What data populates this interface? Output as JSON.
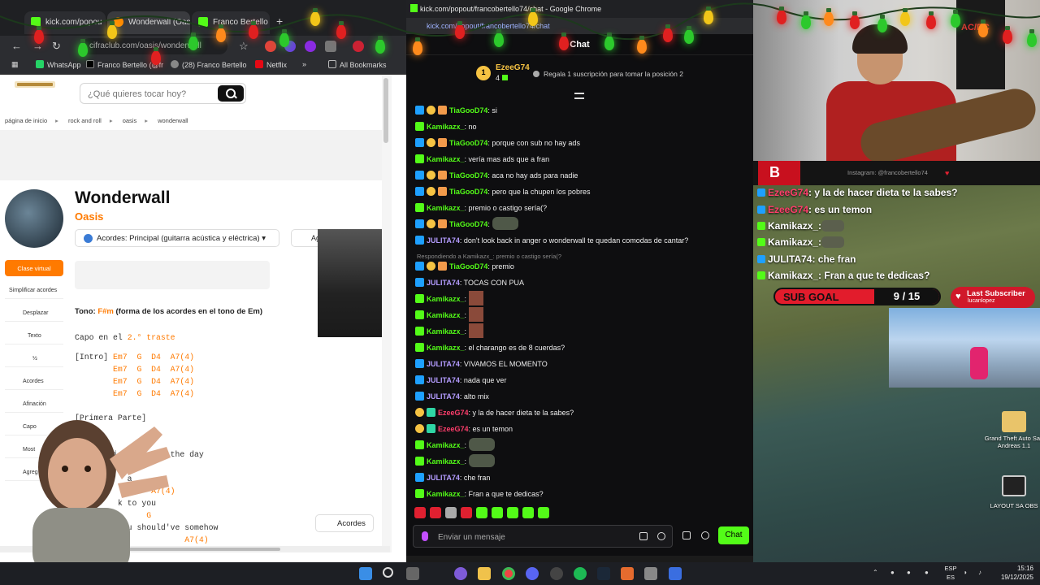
{
  "left_browser": {
    "tabs": [
      {
        "title": "kick.com/popou"
      },
      {
        "title": "Wonderwall (Oasis"
      },
      {
        "title": "Franco Bertello"
      }
    ],
    "url": "cifraclub.com/oasis/wonderwall",
    "bookmarks": [
      "WhatsApp",
      "Franco Bertello (@fr",
      "(28) Franco Bertello",
      "Netflix",
      "All Bookmarks"
    ],
    "site": {
      "search_placeholder": "¿Qué quieres tocar hoy?",
      "breadcrumb": [
        "página de inicio",
        "rock and roll",
        "oasis",
        "wonderwall"
      ],
      "song_title": "Wonderwall",
      "artist": "Oasis",
      "chords_select": "Acordes: Principal (guitarra acústica y eléctrica)",
      "ag_button": "Ag",
      "clase_virtual": "Clase virtual",
      "side_tools": [
        "Simplificar acordes",
        "Desplazar",
        "Texto",
        "½",
        "Acordes",
        "Afinación",
        "Capo",
        "Most",
        "Agreg"
      ],
      "tono_label": "Tono:",
      "tono_key": "F#m",
      "tono_desc": "(forma de los acordes en el tono de Em)",
      "capo_label": "Capo en el",
      "capo_value": "2.° traste",
      "intro_label": "[Intro]",
      "intro_chords": [
        "Em7",
        "G",
        "D4",
        "A7(4)"
      ],
      "primera_parte": "[Primera Parte]",
      "lyric_chords": [
        "G",
        "D4",
        "A7(4)",
        "G",
        "A7(4)"
      ],
      "lyric_lines": [
        "y is gonna be the day",
        "a",
        "k to you",
        "you should've somehow"
      ],
      "acordes_button": "Acordes"
    }
  },
  "chat": {
    "window_title": "kick.com/popout/francobertello74/chat - Google Chrome",
    "url": "kick.com/popout/francobertello74/chat",
    "header": "Chat",
    "pinned": {
      "rank": "1",
      "user": "EzeeG74",
      "count": "4",
      "gift_text": "Regala 1 suscripción para tomar la posición 2"
    },
    "messages": [
      {
        "user": "TiaGooD74",
        "color": "#53fc18",
        "text": ": si",
        "badges": [
          "blue",
          "gold",
          "cake"
        ]
      },
      {
        "user": "Kamikazx_",
        "color": "#53fc18",
        "text": ": no",
        "badges": [
          "green"
        ]
      },
      {
        "user": "TiaGooD74",
        "color": "#53fc18",
        "text": ": porque con sub no hay ads",
        "badges": [
          "blue",
          "gold",
          "cake"
        ]
      },
      {
        "user": "Kamikazx_",
        "color": "#53fc18",
        "text": ": vería mas ads que a fran",
        "badges": [
          "green"
        ]
      },
      {
        "user": "TiaGooD74",
        "color": "#53fc18",
        "text": ": aca no hay ads para nadie",
        "badges": [
          "blue",
          "gold",
          "cake"
        ]
      },
      {
        "user": "TiaGooD74",
        "color": "#53fc18",
        "text": ": pero que la chupen los pobres",
        "badges": [
          "blue",
          "gold",
          "cake"
        ]
      },
      {
        "user": "Kamikazx_",
        "color": "#53fc18",
        "text": ": premio o castigo sería(?",
        "badges": [
          "green"
        ]
      },
      {
        "user": "TiaGooD74",
        "color": "#53fc18",
        "text": ":",
        "badges": [
          "blue",
          "gold",
          "cake"
        ],
        "emote": "wide"
      },
      {
        "user": "JULITA74",
        "color": "#b49cff",
        "text": ": don't look back in anger o wonderwall te quedan comodas de cantar?",
        "badges": [
          "blue"
        ]
      },
      {
        "reply": "Respondiendo a Kamikazx_: premio o castigo sería(?"
      },
      {
        "user": "TiaGooD74",
        "color": "#53fc18",
        "text": ": premio",
        "badges": [
          "blue",
          "gold",
          "cake"
        ]
      },
      {
        "user": "JULITA74",
        "color": "#b49cff",
        "text": ": TOCAS CON PUA",
        "badges": [
          "blue"
        ]
      },
      {
        "user": "Kamikazx_",
        "color": "#53fc18",
        "text": ":",
        "badges": [
          "green"
        ],
        "emote": "square"
      },
      {
        "user": "Kamikazx_",
        "color": "#53fc18",
        "text": ":",
        "badges": [
          "green"
        ],
        "emote": "square"
      },
      {
        "user": "Kamikazx_",
        "color": "#53fc18",
        "text": ":",
        "badges": [
          "green"
        ],
        "emote": "square"
      },
      {
        "user": "Kamikazx_",
        "color": "#53fc18",
        "text": ": el charango es de 8 cuerdas?",
        "badges": [
          "green"
        ]
      },
      {
        "user": "JULITA74",
        "color": "#b49cff",
        "text": ": VIVAMOS EL MOMENTO",
        "badges": [
          "blue"
        ]
      },
      {
        "user": "JULITA74",
        "color": "#b49cff",
        "text": ": nada que ver",
        "badges": [
          "blue"
        ]
      },
      {
        "user": "JULITA74",
        "color": "#b49cff",
        "text": ": alto mix",
        "badges": [
          "blue"
        ]
      },
      {
        "user": "EzeeG74",
        "color": "#ff3d6b",
        "text": ": y la de hacer dieta te la sabes?",
        "badges": [
          "gold",
          "teal"
        ]
      },
      {
        "user": "EzeeG74",
        "color": "#ff3d6b",
        "text": ": es un temon",
        "badges": [
          "gold",
          "teal"
        ]
      },
      {
        "user": "Kamikazx_",
        "color": "#53fc18",
        "text": ":",
        "badges": [
          "green"
        ],
        "emote": "wide"
      },
      {
        "user": "Kamikazx_",
        "color": "#53fc18",
        "text": ":",
        "badges": [
          "green"
        ],
        "emote": "wide"
      },
      {
        "user": "JULITA74",
        "color": "#b49cff",
        "text": ": che fran",
        "badges": [
          "blue"
        ]
      },
      {
        "user": "Kamikazx_",
        "color": "#53fc18",
        "text": ": Fran a que te dedicas?",
        "badges": [
          "green"
        ]
      }
    ],
    "input_placeholder": "Enviar un mensaje",
    "send_label": "Chat"
  },
  "stream_overlay": {
    "instagram": "Instagram: @francobertello74",
    "poster_text": "AC/DC",
    "messages": [
      {
        "user": "EzeeG74",
        "text": ": y la de hacer dieta te la sabes?",
        "color": "#ff3d6b"
      },
      {
        "user": "EzeeG74",
        "text": ": es un temon",
        "color": "#ff3d6b"
      },
      {
        "user": "Kamikazx_",
        "text": ":",
        "color": "#ffffff",
        "emote": true
      },
      {
        "user": "Kamikazx_",
        "text": ":",
        "color": "#ffffff",
        "emote": true
      },
      {
        "user": "JULITA74",
        "text": ": che fran",
        "color": "#ffffff"
      },
      {
        "user": "Kamikazx_",
        "text": ": Fran a que te dedicas?",
        "color": "#ffffff"
      }
    ],
    "sub_goal_label": "SUB GOAL",
    "sub_goal_current": 9,
    "sub_goal_target": 15,
    "sub_goal_text": "9 / 15",
    "last_subscriber_label": "Last Subscriber",
    "last_subscriber_name": "lucanlopez"
  },
  "desktop_icons": [
    {
      "label": "Grand Theft Auto San Andreas 1.1"
    },
    {
      "label": "LAYOUT SA OBS"
    }
  ],
  "taskbar": {
    "lang_top": "ESP",
    "lang_bottom": "ES",
    "time": "15:16",
    "date": "19/12/2025"
  }
}
